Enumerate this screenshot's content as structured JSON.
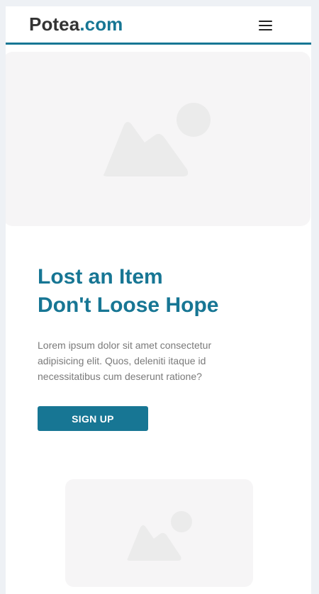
{
  "header": {
    "brand_name": "Potea",
    "brand_tld": ".com",
    "menu_icon": "hamburger-menu-icon"
  },
  "hero": {
    "image_icon": "image-placeholder-icon",
    "title_line1": "Lost an Item",
    "title_line2": "Don't Loose Hope",
    "description": "Lorem ipsum dolor sit amet consectetur adipisicing elit. Quos, deleniti itaque id necessitatibus cum deserunt ratione?",
    "cta_label": "SIGN UP"
  },
  "secondary": {
    "image_icon": "image-placeholder-icon"
  },
  "colors": {
    "accent": "#177694",
    "brand_text": "#333333",
    "body_text": "#7a7a7a",
    "placeholder_bg": "#f6f5f6",
    "placeholder_shape": "#ebebeb",
    "page_bg": "#eef1f5"
  }
}
